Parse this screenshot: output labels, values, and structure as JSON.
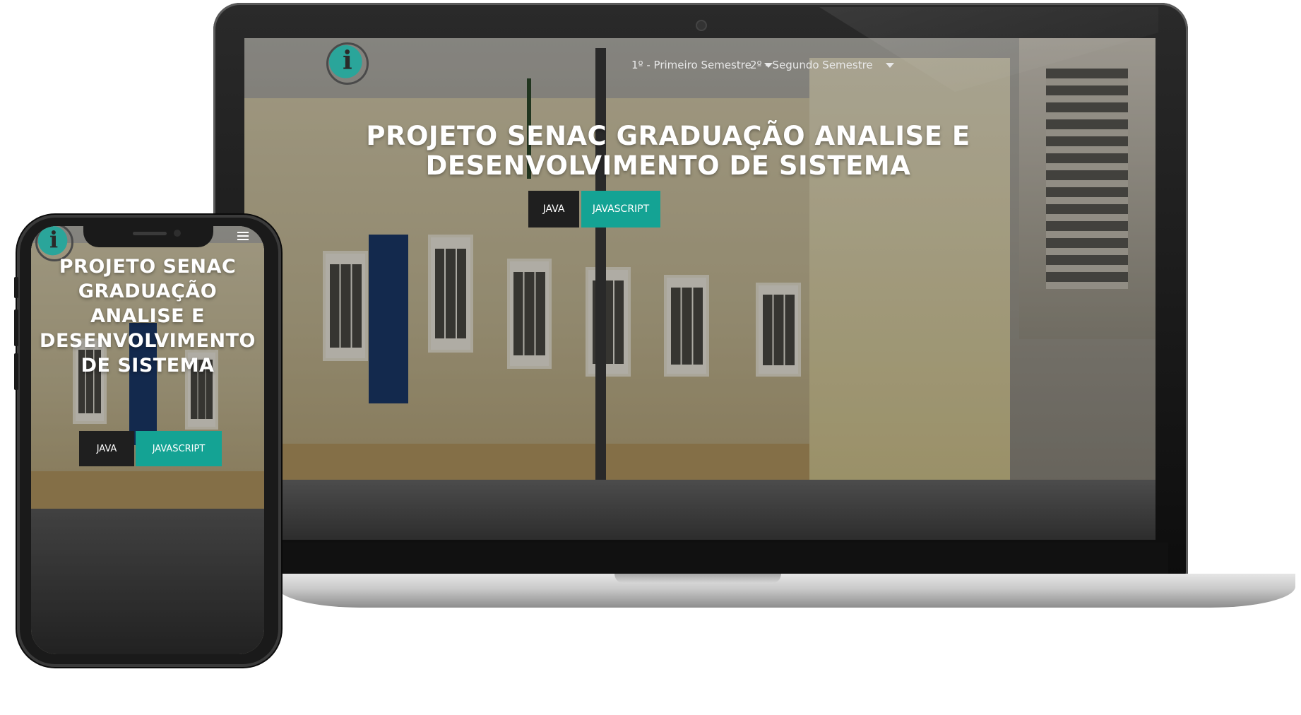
{
  "desktop": {
    "nav": [
      {
        "label": "1º - Primeiro Semestre"
      },
      {
        "label": "2º - Segundo Semestre"
      }
    ],
    "hero": {
      "title_line1": "PROJETO SENAC GRADUAÇÃO ANALISE E",
      "title_line2": "DESENVOLVIMENTO DE SISTEMA"
    },
    "buttons": {
      "java": "JAVA",
      "javascript": "JAVASCRIPT"
    },
    "logo_letter": "i"
  },
  "mobile": {
    "hero": {
      "line1": "PROJETO SENAC",
      "line2": "GRADUAÇÃO",
      "line3": "ANALISE E",
      "line4": "DESENVOLVIMENTO",
      "line5": "DE SISTEMA"
    },
    "buttons": {
      "java": "JAVA",
      "javascript": "JAVASCRIPT"
    },
    "logo_letter": "i"
  },
  "colors": {
    "accent_teal": "#14a394",
    "button_dark": "#1f1f1f",
    "hero_text": "#ffffff"
  },
  "icons": [
    "logo-icon",
    "chevron-down-icon",
    "hamburger-menu-icon"
  ]
}
